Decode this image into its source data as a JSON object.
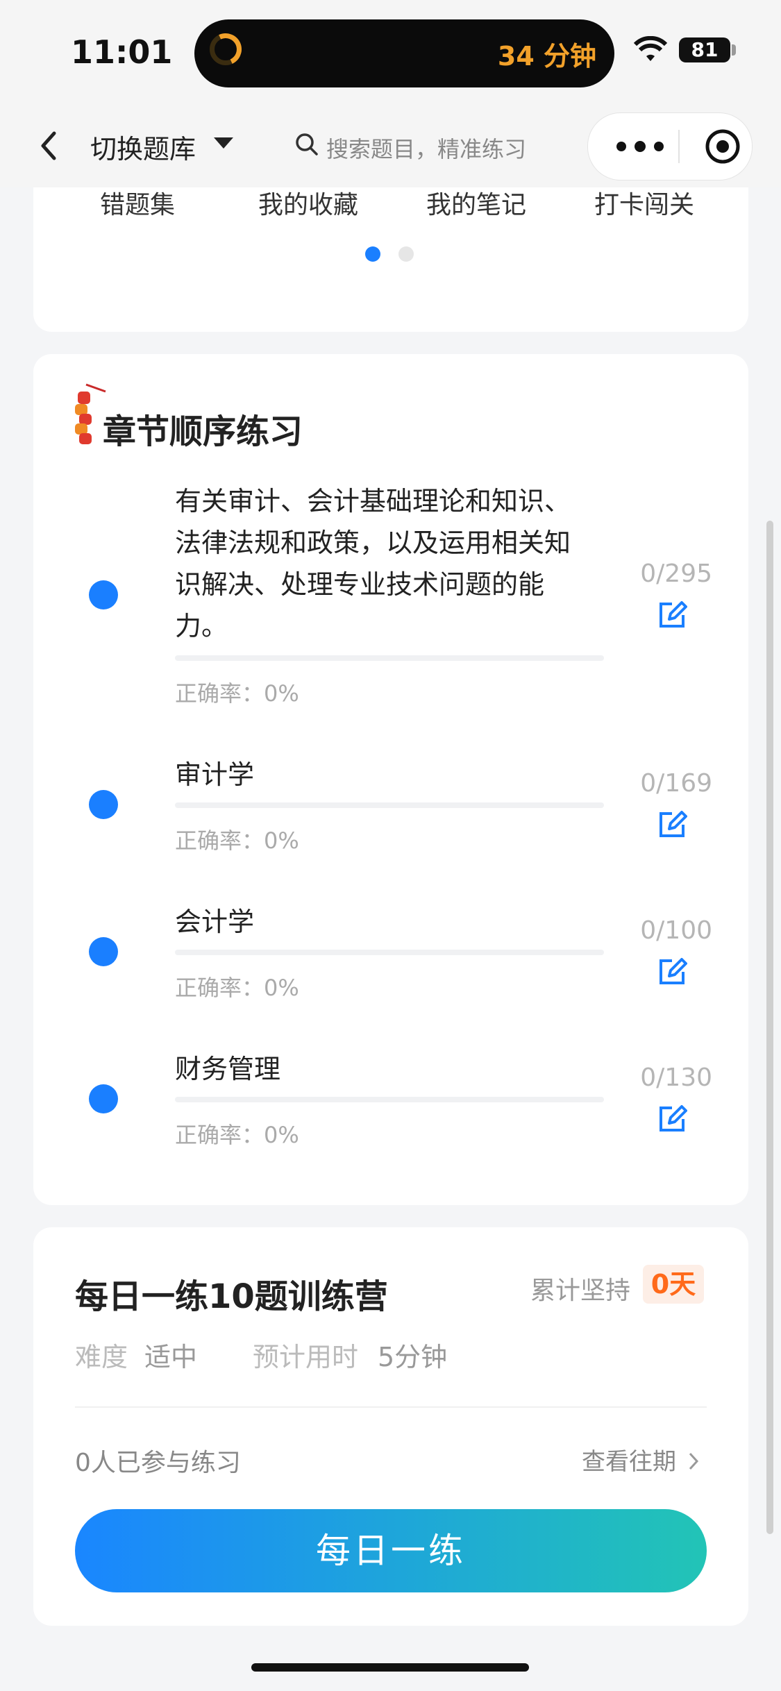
{
  "status_bar": {
    "time": "11:01",
    "island_text": "34 分钟",
    "battery": "81"
  },
  "nav": {
    "switch_label": "切换题库",
    "search_placeholder": "搜索题目，精准练习"
  },
  "tools": [
    {
      "label": "错题集",
      "icon": "wrong-questions-icon"
    },
    {
      "label": "我的收藏",
      "icon": "favorites-icon"
    },
    {
      "label": "我的笔记",
      "icon": "notes-icon"
    },
    {
      "label": "打卡闯关",
      "icon": "checkin-icon"
    }
  ],
  "pager": {
    "total": 2,
    "active": 0
  },
  "chapters": {
    "title": "章节顺序练习",
    "rows": [
      {
        "title": "有关审计、会计基础理论和知识、法律法规和政策，以及运用相关知识解决、处理专业技术问题的能力。",
        "count": "0/295",
        "rate": "正确率：0%",
        "progress": 0
      },
      {
        "title": "审计学",
        "count": "0/169",
        "rate": "正确率：0%",
        "progress": 0
      },
      {
        "title": "会计学",
        "count": "0/100",
        "rate": "正确率：0%",
        "progress": 0
      },
      {
        "title": "财务管理",
        "count": "0/130",
        "rate": "正确率：0%",
        "progress": 0
      }
    ]
  },
  "camp": {
    "title": "每日一练10题训练营",
    "streak_label": "累计坚持",
    "streak_value": "0天",
    "difficulty_label": "难度",
    "difficulty_value": "适中",
    "time_label": "预计用时",
    "time_value": "5分钟",
    "participants": "0人已参与练习",
    "history_link": "查看往期",
    "button": "每日一练"
  },
  "colors": {
    "accent": "#1a7fff",
    "streak": "#ff6a1a",
    "clock": "#f2a12a"
  }
}
